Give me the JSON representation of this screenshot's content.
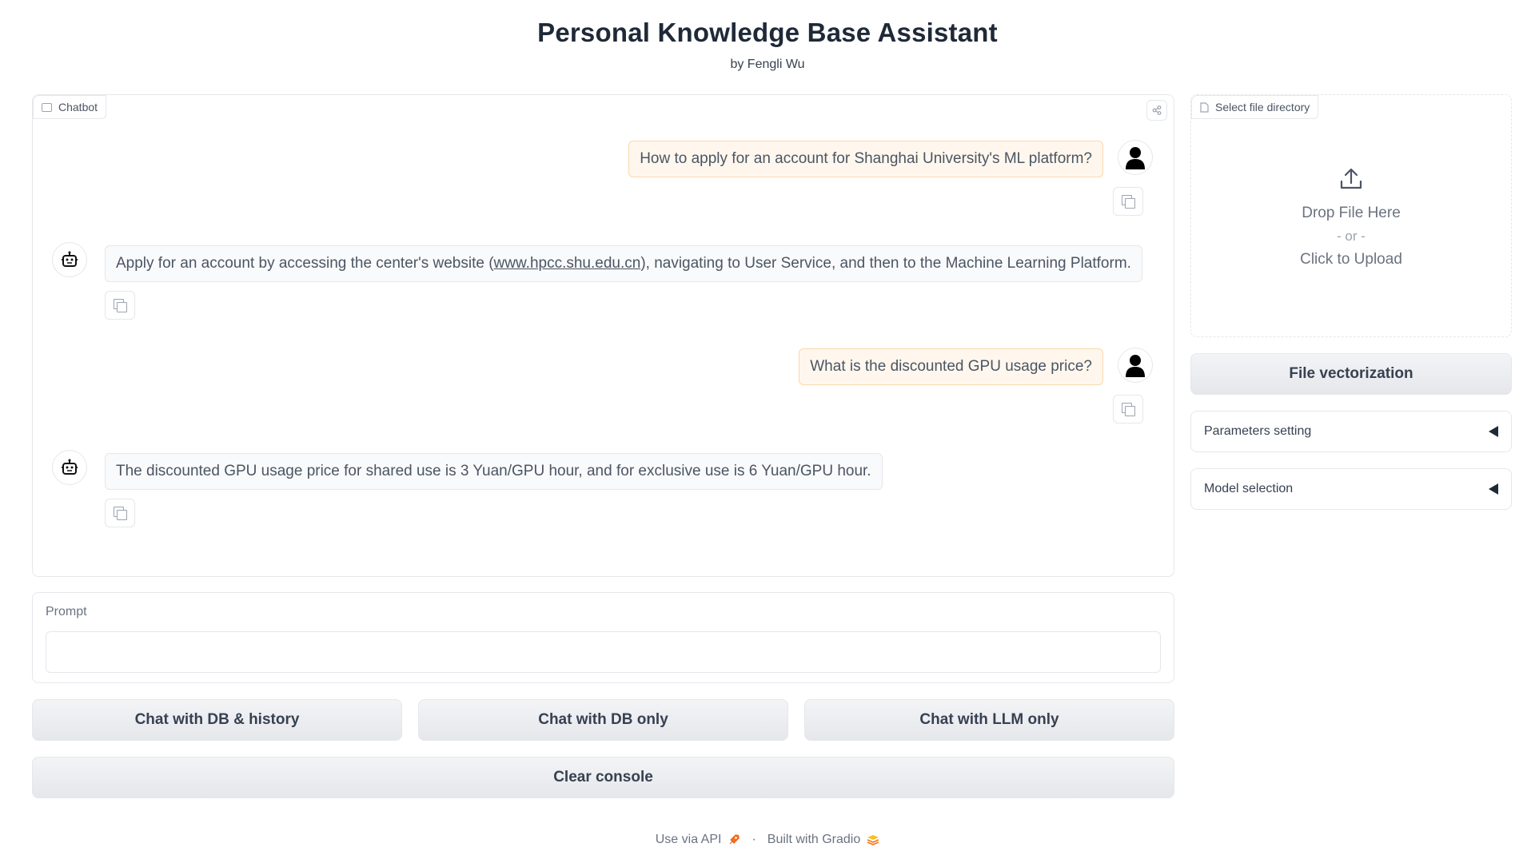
{
  "header": {
    "title": "Personal Knowledge Base Assistant",
    "subtitle": "by Fengli Wu"
  },
  "chatbot": {
    "label": "Chatbot",
    "messages": [
      {
        "role": "user",
        "text": "How to apply for an account for Shanghai University's ML platform?"
      },
      {
        "role": "bot",
        "text_before": "Apply for an account by accessing the center's website (",
        "link": "www.hpcc.shu.edu.cn",
        "text_after": "), navigating to User Service, and then to the Machine Learning Platform."
      },
      {
        "role": "user",
        "text": "What is the discounted GPU usage price?"
      },
      {
        "role": "bot",
        "text": "The discounted GPU usage price for shared use is 3 Yuan/GPU hour, and for exclusive use is 6 Yuan/GPU hour."
      }
    ]
  },
  "prompt": {
    "label": "Prompt",
    "value": "",
    "placeholder": ""
  },
  "buttons": {
    "chat_db_history": "Chat with DB & history",
    "chat_db_only": "Chat with DB only",
    "chat_llm_only": "Chat with LLM only",
    "clear_console": "Clear console",
    "file_vectorization": "File vectorization"
  },
  "upload": {
    "label": "Select file directory",
    "drop_text": "Drop File Here",
    "or_text": "- or -",
    "click_text": "Click to Upload"
  },
  "accordions": {
    "parameters": "Parameters setting",
    "model": "Model selection"
  },
  "footer": {
    "api": "Use via API",
    "separator": "·",
    "built": "Built with Gradio"
  },
  "colors": {
    "user_bubble_bg": "#fff7ed",
    "user_bubble_border": "#fed7aa",
    "bot_bubble_bg": "#f9fafb",
    "button_bg": "#e5e7eb"
  }
}
